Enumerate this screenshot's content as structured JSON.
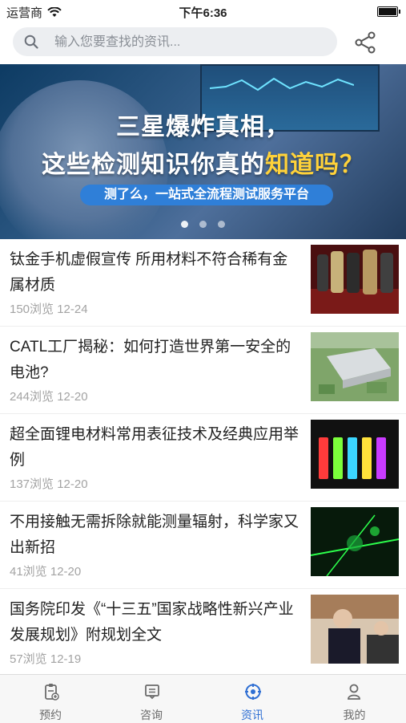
{
  "status_bar": {
    "carrier": "运营商",
    "time": "下午6:36"
  },
  "search": {
    "placeholder": "输入您要查找的资讯..."
  },
  "banner": {
    "line1": "三星爆炸真相，",
    "line2_prefix": "这些检测知识你真的",
    "line2_highlight": "知道吗？",
    "pill_text": "测了么，一站式全流程测试服务平台",
    "page_count": 3,
    "active_index": 0
  },
  "news": [
    {
      "title": "钛金手机虚假宣传 所用材料不符合稀有金属材质",
      "views": "150浏览",
      "date": "12-24",
      "thumb": "phones"
    },
    {
      "title": "CATL工厂揭秘：如何打造世界第一安全的电池?",
      "views": "244浏览",
      "date": "12-20",
      "thumb": "factory"
    },
    {
      "title": "超全面锂电材料常用表征技术及经典应用举例",
      "views": "137浏览",
      "date": "12-20",
      "thumb": "batteries"
    },
    {
      "title": "不用接触无需拆除就能测量辐射，科学家又出新招",
      "views": "41浏览",
      "date": "12-20",
      "thumb": "lasers"
    },
    {
      "title": "国务院印发《“十三五”国家战略性新兴产业发展规划》附规划全文",
      "views": "57浏览",
      "date": "12-19",
      "thumb": "meeting"
    }
  ],
  "tabs": [
    {
      "label": "预约",
      "icon": "clipboard-icon",
      "active": false
    },
    {
      "label": "咨询",
      "icon": "message-icon",
      "active": false
    },
    {
      "label": "资讯",
      "icon": "compass-icon",
      "active": true
    },
    {
      "label": "我的",
      "icon": "person-icon",
      "active": false
    }
  ],
  "colors": {
    "accent": "#2f6fd3",
    "highlight": "#ffd23a"
  }
}
